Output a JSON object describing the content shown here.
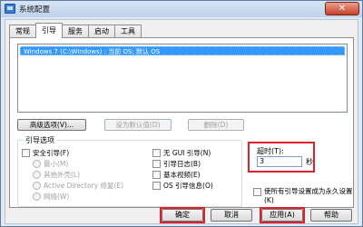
{
  "window": {
    "title": "系统配置",
    "close_glyph": "✕"
  },
  "tabs": [
    {
      "label": "常规",
      "active": false
    },
    {
      "label": "引导",
      "active": true
    },
    {
      "label": "服务",
      "active": false
    },
    {
      "label": "启动",
      "active": false
    },
    {
      "label": "工具",
      "active": false
    }
  ],
  "boot_list": {
    "entries": [
      "Windows 7 (C:\\Windows) : 当前 OS; 默认 OS"
    ]
  },
  "list_buttons": {
    "advanced": "高级选项(V)...",
    "set_default": "设为默认值(D)",
    "delete": "删除(D)"
  },
  "boot_options": {
    "title": "引导选项",
    "safe_boot": "安全引导(F)",
    "minimal": "最小(M)",
    "alternate_shell": "其他外壳(L)",
    "ad_repair": "Active Directory 修复(E)",
    "network": "网络(W)",
    "no_gui": "无 GUI 引导(N)",
    "boot_log": "引导日志(B)",
    "base_video": "基本视频(E)",
    "os_boot_info": "OS 引导信息(O)"
  },
  "timeout": {
    "label": "超时(T):",
    "value": "3",
    "unit": "秒"
  },
  "make_permanent": "使所有引导设置成为永久设置(K)",
  "dialog_buttons": {
    "ok": "确定",
    "cancel": "取消",
    "apply": "应用(A)",
    "help": "帮助"
  },
  "colors": {
    "highlight": "#e0202a",
    "selection": "#3399ff"
  }
}
